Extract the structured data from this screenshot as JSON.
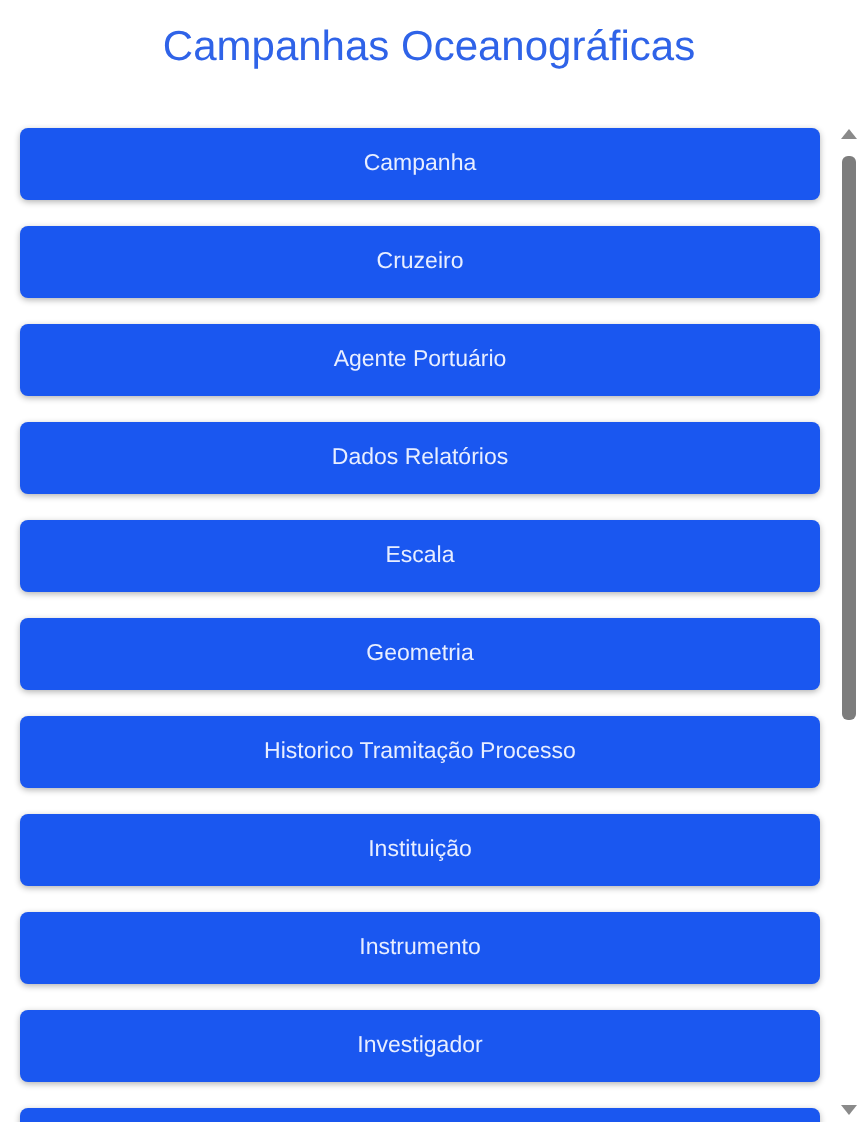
{
  "title": "Campanhas Oceanográficas",
  "menu_buttons": [
    {
      "label": "Campanha"
    },
    {
      "label": "Cruzeiro"
    },
    {
      "label": "Agente Portuário"
    },
    {
      "label": "Dados Relatórios"
    },
    {
      "label": "Escala"
    },
    {
      "label": "Geometria"
    },
    {
      "label": "Historico Tramitação Processo"
    },
    {
      "label": "Instituição"
    },
    {
      "label": "Instrumento"
    },
    {
      "label": "Investigador"
    }
  ]
}
